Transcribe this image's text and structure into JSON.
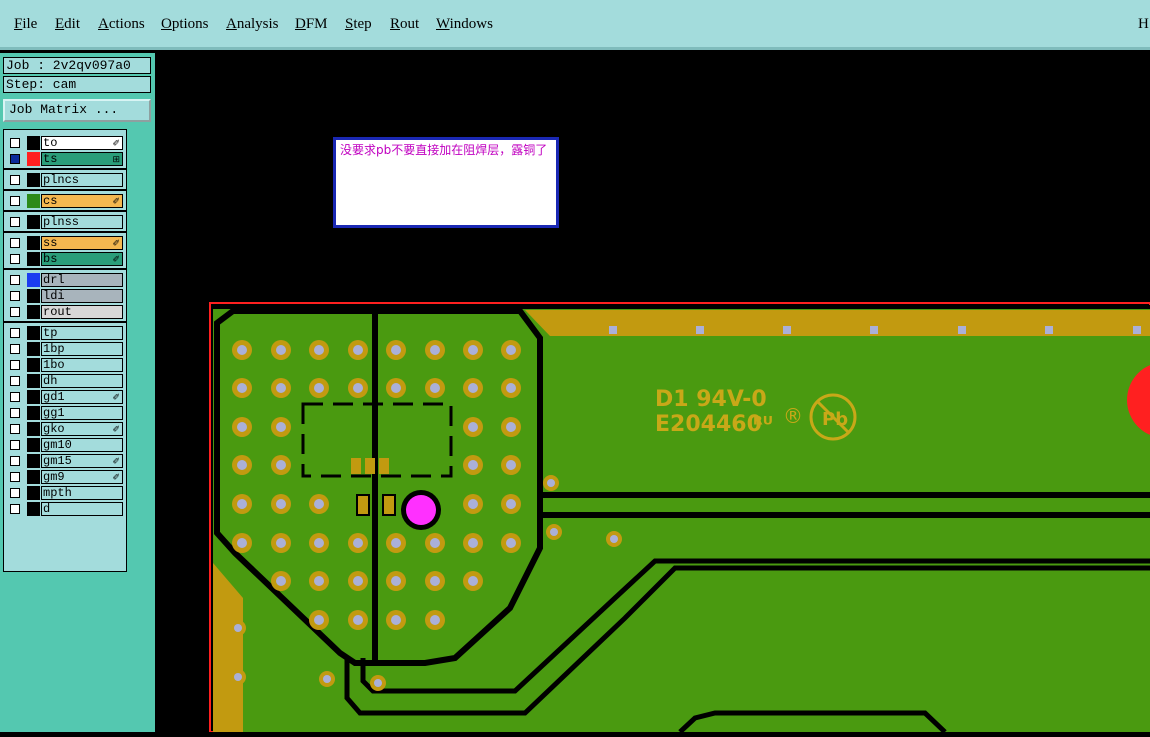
{
  "menu": [
    {
      "key": "F",
      "rest": "ile"
    },
    {
      "key": "E",
      "rest": "dit"
    },
    {
      "key": "A",
      "rest": "ctions"
    },
    {
      "key": "O",
      "rest": "ptions"
    },
    {
      "key": "A",
      "rest": "nalysis"
    },
    {
      "key": "D",
      "rest": "FM"
    },
    {
      "key": "S",
      "rest": "tep"
    },
    {
      "key": "R",
      "rest": "out"
    },
    {
      "key": "W",
      "rest": "indows"
    }
  ],
  "menu_edge": "H",
  "job": {
    "label": "Job : 2v2qv097a0",
    "step": "Step: cam",
    "matrix_button": "Job Matrix ..."
  },
  "layers": [
    {
      "name": "to",
      "bg": "#ffffff",
      "swatch": "#000000",
      "flag": "✐",
      "checked": false
    },
    {
      "name": "ts",
      "bg": "#2a9e7a",
      "swatch": "#ff2020",
      "flag": "⊞",
      "checked": true
    },
    {
      "name": "plncs",
      "bg": "#a3dcdc",
      "swatch": "#000000",
      "flag": "",
      "checked": false
    },
    {
      "name": "cs",
      "bg": "#f4b850",
      "swatch": "#2c8a18",
      "flag": "✐",
      "checked": false
    },
    {
      "name": "plnss",
      "bg": "#a3dcdc",
      "swatch": "#000000",
      "flag": "",
      "checked": false
    },
    {
      "name": "ss",
      "bg": "#f4b850",
      "swatch": "#000000",
      "flag": "✐",
      "checked": false
    },
    {
      "name": "bs",
      "bg": "#2a9e7a",
      "swatch": "#000000",
      "flag": "✐",
      "checked": false
    },
    {
      "name": "drl",
      "bg": "#a8b4bc",
      "swatch": "#1a3cf0",
      "flag": "",
      "checked": false
    },
    {
      "name": "ldi",
      "bg": "#a8b4bc",
      "swatch": "#000000",
      "flag": "",
      "checked": false
    },
    {
      "name": "rout",
      "bg": "#d8d8d8",
      "swatch": "#000000",
      "flag": "",
      "checked": false
    },
    {
      "name": "tp",
      "bg": "#a3dcdc",
      "swatch": "#000000",
      "flag": "",
      "checked": false
    },
    {
      "name": "1bp",
      "bg": "#a3dcdc",
      "swatch": "#000000",
      "flag": "",
      "checked": false
    },
    {
      "name": "1bo",
      "bg": "#a3dcdc",
      "swatch": "#000000",
      "flag": "",
      "checked": false
    },
    {
      "name": "dh",
      "bg": "#a3dcdc",
      "swatch": "#000000",
      "flag": "",
      "checked": false
    },
    {
      "name": "gd1",
      "bg": "#a3dcdc",
      "swatch": "#000000",
      "flag": "✐",
      "checked": false
    },
    {
      "name": "gg1",
      "bg": "#a3dcdc",
      "swatch": "#000000",
      "flag": "",
      "checked": false
    },
    {
      "name": "gko",
      "bg": "#a3dcdc",
      "swatch": "#000000",
      "flag": "✐",
      "checked": false
    },
    {
      "name": "gm10",
      "bg": "#a3dcdc",
      "swatch": "#000000",
      "flag": "",
      "checked": false
    },
    {
      "name": "gm15",
      "bg": "#a3dcdc",
      "swatch": "#000000",
      "flag": "✐",
      "checked": false
    },
    {
      "name": "gm9",
      "bg": "#a3dcdc",
      "swatch": "#000000",
      "flag": "✐",
      "checked": false
    },
    {
      "name": "mpth",
      "bg": "#a3dcdc",
      "swatch": "#000000",
      "flag": "",
      "checked": false
    },
    {
      "name": "d",
      "bg": "#a3dcdc",
      "swatch": "#000000",
      "flag": "",
      "checked": false
    }
  ],
  "note": {
    "text": "没要求pb不要直接加在阻焊层，露铜了"
  },
  "board": {
    "marking_line1": "D1  94V-0",
    "marking_line2": "E204460",
    "ul_mark": "ᴿᵁ",
    "reg_mark": "®",
    "pb_mark": "Pb",
    "colors": {
      "board": "#4a9a10",
      "mask": "#3a8a0a",
      "pad": "#c29a10",
      "hole": "#aab0d8",
      "outline": "#ff2020",
      "via": "#ff30ff",
      "silk": "#c8a818"
    }
  }
}
